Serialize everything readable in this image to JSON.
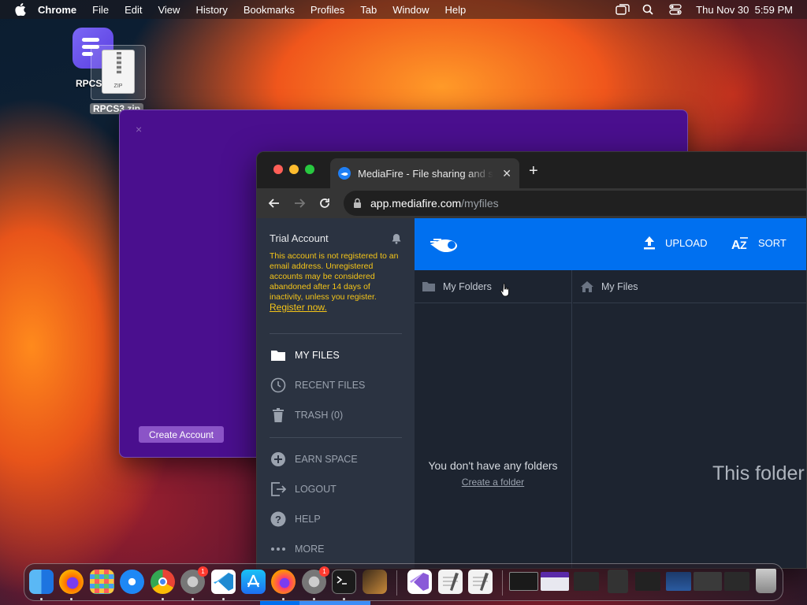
{
  "menubar": {
    "app_name": "Chrome",
    "items": [
      "File",
      "Edit",
      "View",
      "History",
      "Bookmarks",
      "Profiles",
      "Tab",
      "Window",
      "Help"
    ],
    "datetime": "Thu Nov 30  5:59 PM"
  },
  "desktop": {
    "app_icon_label": "RPCS",
    "zip_label": "RPCS3.zip",
    "zip_doc_text": "ZIP"
  },
  "purple_window": {
    "close_glyph": "×",
    "create_account_label": "Create Account"
  },
  "browser": {
    "tab_title": "MediaFire - File sharing and storage",
    "tab_close": "✕",
    "new_tab": "+",
    "url_host": "app.mediafire.com",
    "url_path": "/myfiles"
  },
  "sidebar": {
    "account_title": "Trial Account",
    "warning_text": "This account is not registered to an email address. Unregistered accounts may be considered abandoned after 14 days of inactivity, unless you register.",
    "register_link": "Register now.",
    "nav": [
      {
        "label": "MY FILES",
        "icon": "folder-icon"
      },
      {
        "label": "RECENT FILES",
        "icon": "clock-icon"
      },
      {
        "label": "TRASH (0)",
        "icon": "trash-icon"
      },
      {
        "label": "EARN SPACE",
        "icon": "plus-circle-icon"
      },
      {
        "label": "LOGOUT",
        "icon": "logout-icon"
      },
      {
        "label": "HELP",
        "icon": "help-icon"
      },
      {
        "label": "MORE",
        "icon": "more-icon"
      }
    ]
  },
  "main": {
    "upload_label": "UPLOAD",
    "sort_label": "SORT",
    "folders_header": "My Folders",
    "files_header": "My Files",
    "no_folders_text": "You don't have any folders",
    "create_folder_link": "Create a folder",
    "empty_folder_text": "This folder is empty"
  },
  "dock": {
    "badge_count": "1"
  },
  "colors": {
    "mediafire_blue": "#0070f0",
    "warning_yellow": "#f5c518",
    "purple_window": "#4a0f8e"
  }
}
